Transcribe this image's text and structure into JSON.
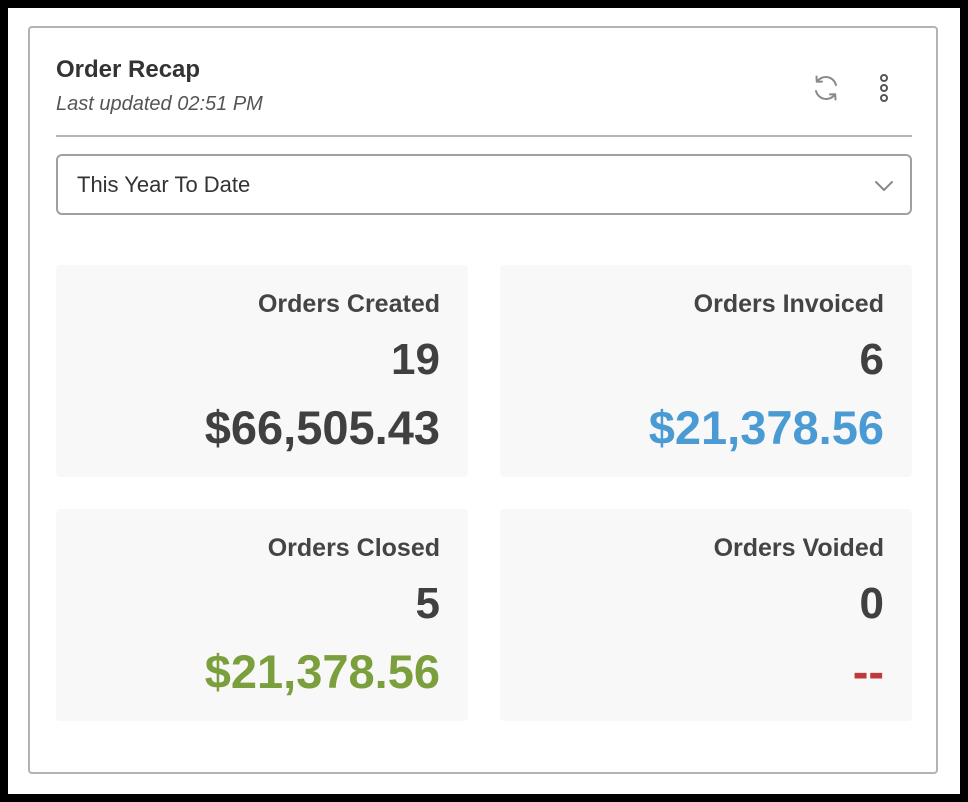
{
  "widget": {
    "title": "Order Recap",
    "last_updated": "Last updated 02:51 PM",
    "refresh_icon": "refresh-icon",
    "menu_icon": "more-vertical-icon"
  },
  "period_select": {
    "value": "This Year To Date",
    "icon": "chevron-down-icon"
  },
  "tiles": [
    {
      "label": "Orders Created",
      "count": "19",
      "amount": "$66,505.43",
      "amount_color": "#404040"
    },
    {
      "label": "Orders Invoiced",
      "count": "6",
      "amount": "$21,378.56",
      "amount_color": "#4a9ad4"
    },
    {
      "label": "Orders Closed",
      "count": "5",
      "amount": "$21,378.56",
      "amount_color": "#7a9f3c"
    },
    {
      "label": "Orders Voided",
      "count": "0",
      "amount": "--",
      "amount_color": "#c0393b"
    }
  ]
}
